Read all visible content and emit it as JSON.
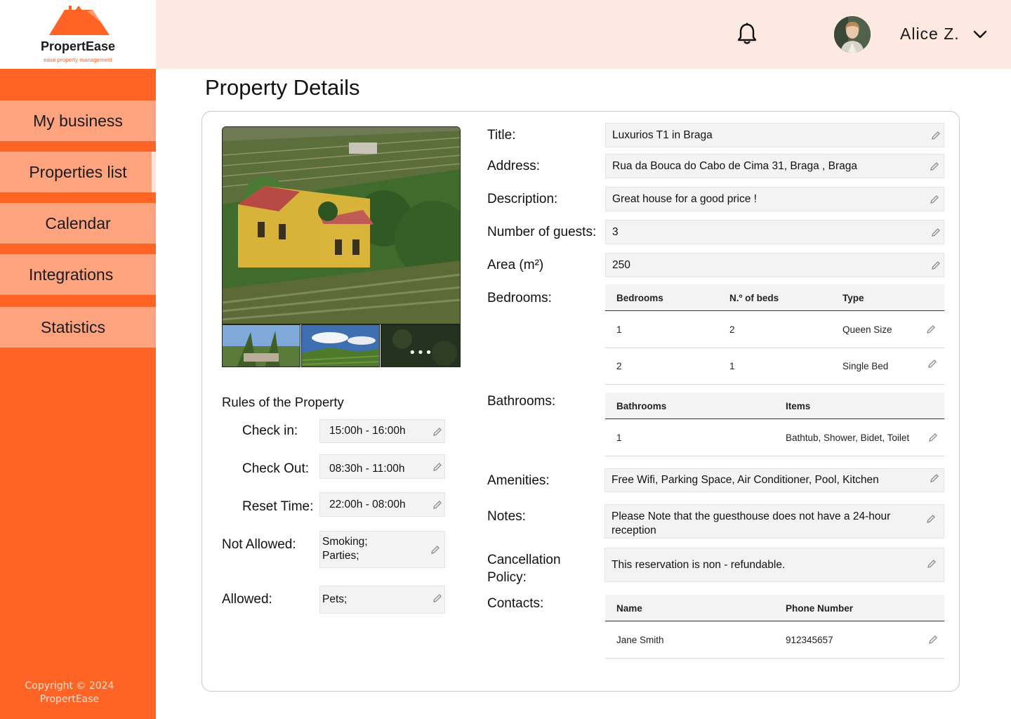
{
  "brand": {
    "name": "PropertEase",
    "tagline": "ease property management",
    "accent": "#ff6425",
    "nav_bg": "#fda47e",
    "header_bg": "#fde9e1"
  },
  "sidebar": {
    "items": [
      {
        "label": "My business"
      },
      {
        "label": "Properties list"
      },
      {
        "label": "Calendar"
      },
      {
        "label": "Integrations"
      },
      {
        "label": "Statistics"
      }
    ],
    "active": "Properties list",
    "copyright": "Copyright © 2024 PropertEase"
  },
  "header": {
    "user_name": "Alice Z.",
    "icons": [
      "bell-icon",
      "avatar",
      "chevron-down-icon"
    ]
  },
  "page": {
    "title": "Property Details"
  },
  "rules": {
    "heading": "Rules of the Property",
    "checkin_label": "Check in:",
    "checkin_value": "15:00h - 16:00h",
    "checkout_label": "Check Out:",
    "checkout_value": "08:30h - 11:00h",
    "reset_label": "Reset Time:",
    "reset_value": "22:00h - 08:00h",
    "not_allowed_label": "Not Allowed:",
    "not_allowed_value": "Smoking;\nParties;",
    "allowed_label": "Allowed:",
    "allowed_value": "Pets;"
  },
  "details": {
    "title_label": "Title:",
    "title_value": "Luxurios T1 in Braga",
    "address_label": "Address:",
    "address_value": "Rua da Bouca do Cabo de Cima 31, Braga , Braga",
    "description_label": "Description:",
    "description_value": "Great house for a good price !",
    "guests_label": "Number of guests:",
    "guests_value": "3",
    "area_label": "Area (m²)",
    "area_value": "250",
    "bedrooms_label": "Bedrooms:",
    "bathrooms_label": "Bathrooms:",
    "amenities_label": "Amenities:",
    "amenities_value": "Free Wifi, Parking Space, Air Conditioner, Pool, Kitchen",
    "notes_label": "Notes:",
    "notes_value": "Please Note that the guesthouse does not have a 24-hour reception",
    "cancellation_label": "Cancellation Policy:",
    "cancellation_value": "This reservation is non - refundable.",
    "contacts_label": "Contacts:"
  },
  "bedrooms_table": {
    "headers": [
      "Bedrooms",
      "N.º of beds",
      "Type"
    ],
    "rows": [
      [
        "1",
        "2",
        "Queen Size"
      ],
      [
        "2",
        "1",
        "Single Bed"
      ]
    ]
  },
  "bathrooms_table": {
    "headers": [
      "Bathrooms",
      "Items"
    ],
    "rows": [
      [
        "1",
        "Bathtub, Shower, Bidet, Toilet"
      ]
    ]
  },
  "contacts_table": {
    "headers": [
      "Name",
      "Phone Number"
    ],
    "rows": [
      [
        "Jane Smith",
        "912345657"
      ]
    ]
  },
  "gallery": {
    "more_indicator": "•••"
  }
}
